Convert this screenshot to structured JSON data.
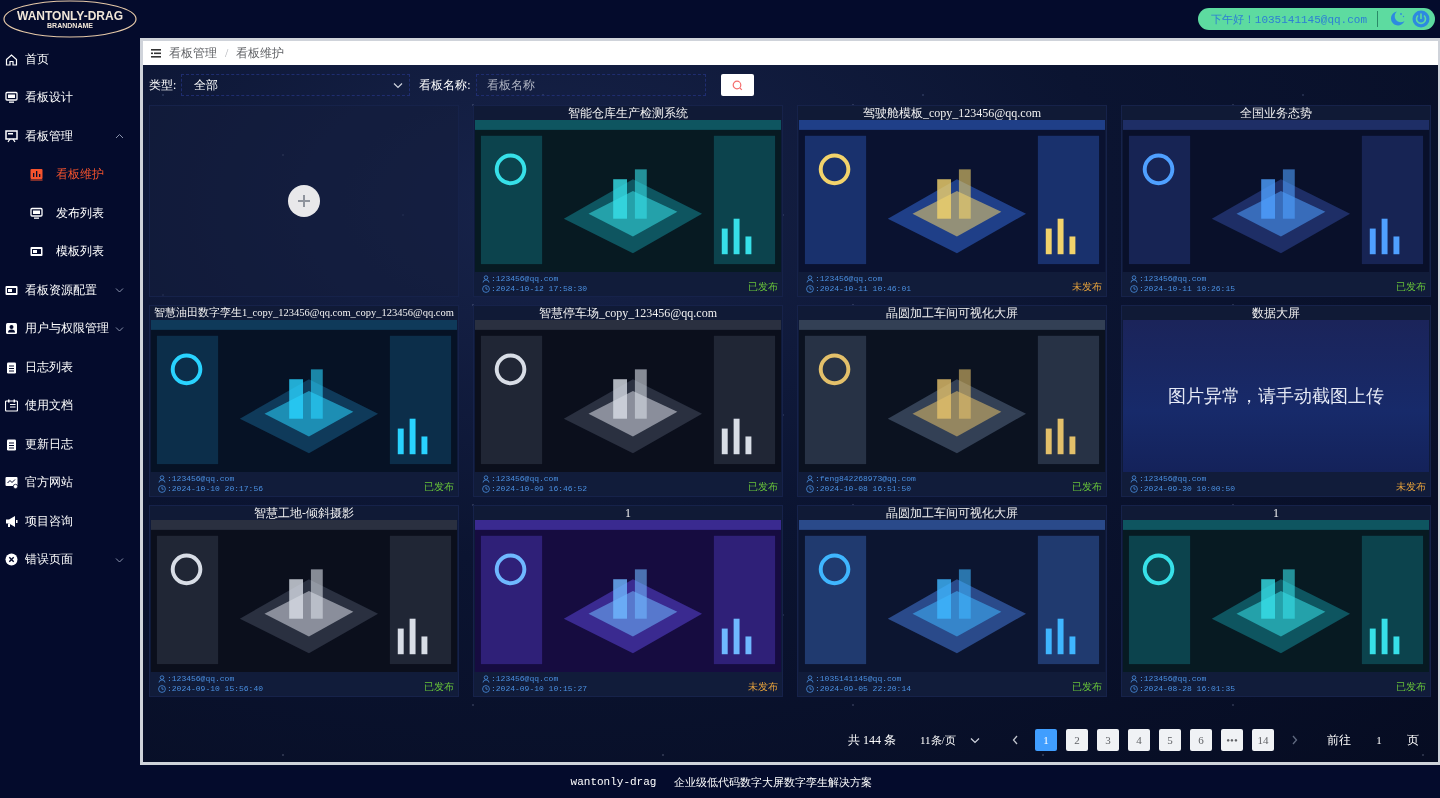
{
  "header": {
    "logo_title": "WANTONLY-DRAG",
    "logo_subtitle": "BRANDNAME",
    "greeting": "下午好！1035141145@qq.com"
  },
  "sidebar": {
    "items": [
      {
        "label": "首页",
        "kind": "home"
      },
      {
        "label": "看板设计",
        "kind": "monitor"
      },
      {
        "label": "看板管理",
        "kind": "board",
        "expanded": true,
        "children": [
          {
            "label": "看板维护",
            "kind": "chart",
            "selected": true
          },
          {
            "label": "发布列表",
            "kind": "monitor",
            "selected": false
          },
          {
            "label": "模板列表",
            "kind": "template",
            "selected": false
          }
        ]
      },
      {
        "label": "看板资源配置",
        "kind": "template",
        "expanded": false
      },
      {
        "label": "用户与权限管理",
        "kind": "user",
        "expanded": false
      },
      {
        "label": "日志列表",
        "kind": "doc"
      },
      {
        "label": "使用文档",
        "kind": "book"
      },
      {
        "label": "更新日志",
        "kind": "doc"
      },
      {
        "label": "官方网站",
        "kind": "site"
      },
      {
        "label": "项目咨询",
        "kind": "megaphone"
      },
      {
        "label": "错误页面",
        "kind": "error",
        "expanded": false
      }
    ]
  },
  "breadcrumb": [
    "看板管理",
    "看板维护"
  ],
  "breadcrumb_separator": "/",
  "filter": {
    "type_label": "类型:",
    "type_value": "全部",
    "name_label": "看板名称:",
    "name_placeholder": "看板名称"
  },
  "cards": [
    {
      "kind": "add"
    },
    {
      "kind": "board",
      "title": "智能仓库生产检测系统",
      "user": ":123456@qq.com",
      "time": ":2024-10-12 17:58:30",
      "status": "已发布",
      "published": true
    },
    {
      "kind": "board",
      "title": "驾驶舱模板_copy_123456@qq.com",
      "user": ":123456@qq.com",
      "time": ":2024-10-11 10:46:01",
      "status": "未发布",
      "published": false
    },
    {
      "kind": "board",
      "title": "全国业务态势",
      "user": ":123456@qq.com",
      "time": ":2024-10-11 10:26:15",
      "status": "已发布",
      "published": true
    },
    {
      "kind": "board",
      "title": "智慧油田数字孪生1_copy_123456@qq.com_copy_123456@qq.com",
      "user": ":123456@qq.com",
      "time": ":2024-10-10 20:17:56",
      "status": "已发布",
      "published": true
    },
    {
      "kind": "board",
      "title": "智慧停车场_copy_123456@qq.com",
      "user": ":123456@qq.com",
      "time": ":2024-10-09 16:46:52",
      "status": "已发布",
      "published": true
    },
    {
      "kind": "board",
      "title": "晶圆加工车间可视化大屏",
      "user": ":feng842268973@qq.com",
      "time": ":2024-10-08 16:51:50",
      "status": "已发布",
      "published": true
    },
    {
      "kind": "board",
      "title": "数据大屏",
      "thumb": {
        "kind": "error",
        "text": "图片异常，请手动截图上传"
      },
      "user": ":123456@qq.com",
      "time": ":2024-09-30 10:00:50",
      "status": "未发布",
      "published": false
    },
    {
      "kind": "board",
      "title": "智慧工地-倾斜摄影",
      "user": ":123456@qq.com",
      "time": ":2024-09-10 15:56:40",
      "status": "已发布",
      "published": true
    },
    {
      "kind": "board",
      "title": "1",
      "user": ":123456@qq.com",
      "time": ":2024-09-10 10:15:27",
      "status": "未发布",
      "published": false
    },
    {
      "kind": "board",
      "title": "晶圆加工车间可视化大屏",
      "user": ":1035141145@qq.com",
      "time": ":2024-09-05 22:20:14",
      "status": "已发布",
      "published": true
    },
    {
      "kind": "board",
      "title": "1",
      "user": ":123456@qq.com",
      "time": ":2024-08-28 16:01:35",
      "status": "已发布",
      "published": true
    }
  ],
  "pagination": {
    "total": "共 144 条",
    "page_size": "11条/页",
    "pages": [
      {
        "label": "1",
        "selected": true
      },
      {
        "label": "2",
        "selected": false
      },
      {
        "label": "3",
        "selected": false
      },
      {
        "label": "4",
        "selected": false
      },
      {
        "label": "5",
        "selected": false
      },
      {
        "label": "6",
        "selected": false
      },
      {
        "label": "•••",
        "selected": false
      },
      {
        "label": "14",
        "selected": false
      }
    ],
    "goto_label": "前往",
    "goto_value": "1",
    "goto_unit": "页"
  },
  "footer": {
    "brand": "wantonly-drag",
    "slogan": "企业级低代码数字大屏数字孪生解决方案"
  }
}
